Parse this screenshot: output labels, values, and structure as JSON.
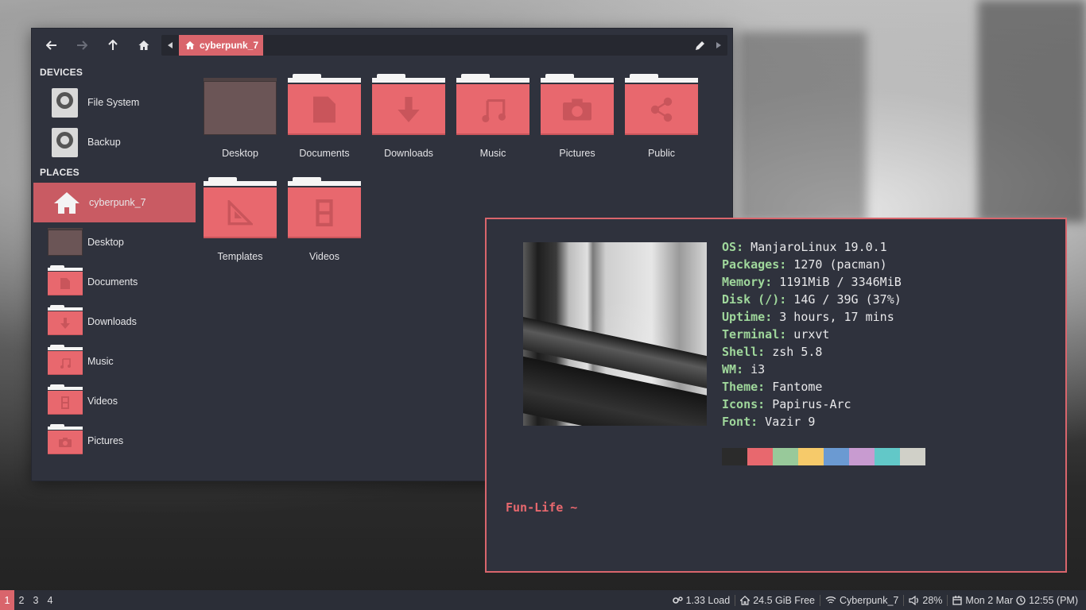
{
  "file_manager": {
    "path": {
      "crumb": "cyberpunk_7"
    },
    "sidebar": {
      "devices_heading": "DEVICES",
      "devices": [
        {
          "label": "File System",
          "icon": "harddisk-icon"
        },
        {
          "label": "Backup",
          "icon": "harddisk-icon"
        }
      ],
      "places_heading": "PLACES",
      "places": [
        {
          "label": "cyberpunk_7",
          "icon": "home-icon"
        },
        {
          "label": "Desktop",
          "icon": "desktop-folder-icon"
        },
        {
          "label": "Documents",
          "icon": "documents-folder-icon"
        },
        {
          "label": "Downloads",
          "icon": "downloads-folder-icon"
        },
        {
          "label": "Music",
          "icon": "music-folder-icon"
        },
        {
          "label": "Videos",
          "icon": "videos-folder-icon"
        },
        {
          "label": "Pictures",
          "icon": "pictures-folder-icon"
        }
      ]
    },
    "folders": [
      {
        "label": "Desktop"
      },
      {
        "label": "Documents"
      },
      {
        "label": "Downloads"
      },
      {
        "label": "Music"
      },
      {
        "label": "Pictures"
      },
      {
        "label": "Public"
      },
      {
        "label": "Templates"
      },
      {
        "label": "Videos"
      }
    ]
  },
  "terminal": {
    "info": [
      {
        "key": "OS",
        "value": " ManjaroLinux 19.0.1"
      },
      {
        "key": "Packages",
        "value": " 1270 (pacman)"
      },
      {
        "key": "Memory",
        "value": " 1191MiB / 3346MiB"
      },
      {
        "key": "Disk (/)",
        "value": " 14G / 39G (37%)"
      },
      {
        "key": "Uptime",
        "value": " 3 hours, 17 mins"
      },
      {
        "key": "Terminal",
        "value": " urxvt"
      },
      {
        "key": "Shell",
        "value": " zsh 5.8"
      },
      {
        "key": "WM",
        "value": " i3"
      },
      {
        "key": "Theme",
        "value": " Fantome"
      },
      {
        "key": "Icons",
        "value": " Papirus-Arc"
      },
      {
        "key": "Font",
        "value": " Vazir 9"
      }
    ],
    "palette": [
      "#2b2b2b",
      "#e8686e",
      "#98c99a",
      "#f6ca6a",
      "#6b9ad2",
      "#c89bd0",
      "#62c8c8",
      "#d0d0c8"
    ],
    "prompt": "Fun-Life ~"
  },
  "statusbar": {
    "workspaces": [
      "1",
      "2",
      "3",
      "4"
    ],
    "load": "1.33 Load",
    "disk": "24.5 GiB Free",
    "wifi": "Cyberpunk_7",
    "volume": "28%",
    "date": "Mon 2 Mar",
    "time": "12:55 (PM)"
  },
  "colors": {
    "accent": "#d9656c",
    "folder": "#e8686e",
    "panel": "#2f323d",
    "key_green": "#9fd79b"
  }
}
